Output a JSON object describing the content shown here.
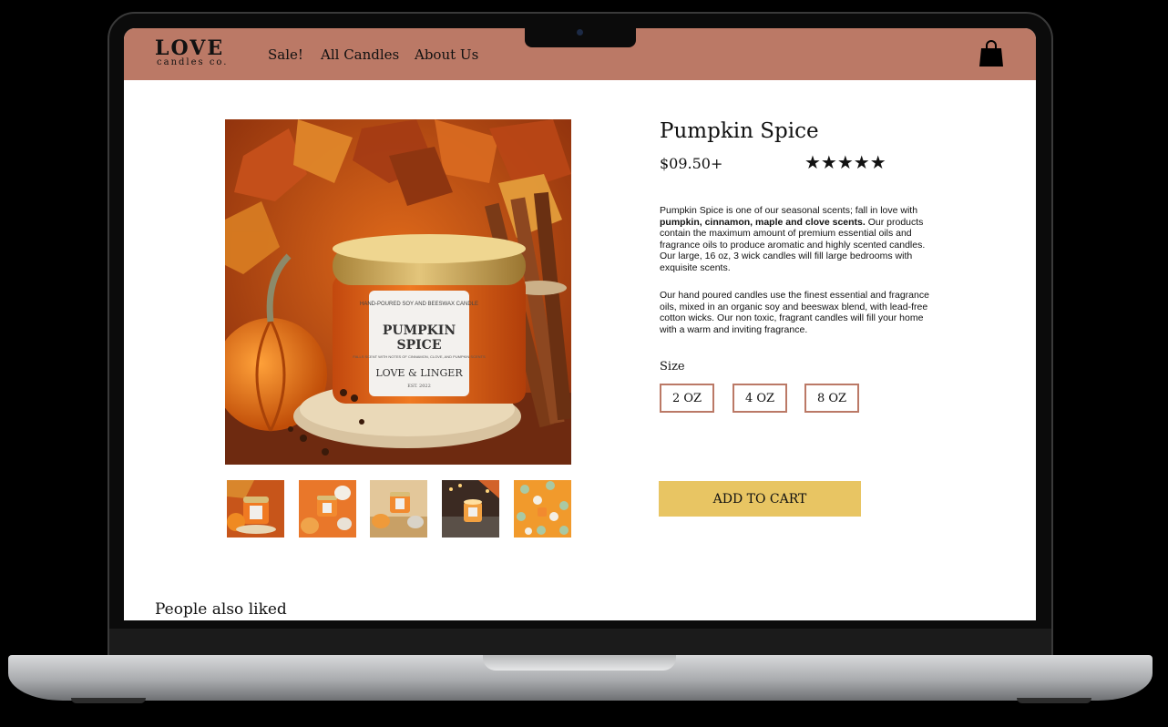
{
  "brand": {
    "logo_main": "LOVE",
    "logo_sub": "candles co."
  },
  "nav": {
    "links": [
      "Sale!",
      "All Candles",
      "About Us"
    ],
    "cart_icon": "shopping-bag-icon"
  },
  "product": {
    "name": "Pumpkin Spice",
    "price": "$09.50+",
    "rating_stars": "★★★★★",
    "rating_value": 5,
    "description1_pre": "Pumpkin Spice is one of our seasonal scents; fall in love with ",
    "description1_bold": "pumpkin, cinnamon, maple and clove scents.",
    "description1_post": " Our products contain the maximum amount of premium essential oils and fragrance oils to produce aromatic and highly scented candles. Our large, 16 oz, 3 wick candles will fill large bedrooms with exquisite scents.",
    "description2": "Our hand poured candles use the finest essential and fragrance oils, mixed in an organic soy and beeswax blend, with lead-free cotton wicks. Our non toxic, fragrant candles will fill your home with a warm and inviting fragrance.",
    "size_label": "Size",
    "sizes": [
      "2 OZ",
      "4 OZ",
      "8 OZ"
    ],
    "add_to_cart": "ADD TO CART",
    "jar_label": {
      "top": "HAND-POURED SOY AND BEESWAX CANDLE",
      "name_line1": "PUMPKIN",
      "name_line2": "SPICE",
      "notes": "FALLS SCENT WITH NOTES OF CINNAMON, CLOVE, AND PUMPKIN SCENTS",
      "maker": "LOVE & LINGER",
      "est": "EST. 2022"
    }
  },
  "related": {
    "title": "People also liked"
  },
  "colors": {
    "nav": "#bb7966",
    "button": "#e8c563",
    "size_border": "#bb7966"
  }
}
